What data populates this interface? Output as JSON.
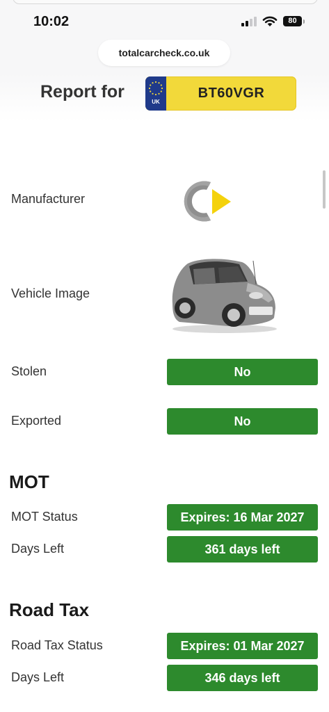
{
  "status_bar": {
    "time": "10:02",
    "battery": "80"
  },
  "browser": {
    "url": "totalcarcheck.co.uk"
  },
  "header": {
    "title": "Report for",
    "plate_country": "UK",
    "registration": "BT60VGR"
  },
  "vehicle": {
    "manufacturer_label": "Manufacturer",
    "manufacturer_logo": "smart-logo",
    "image_label": "Vehicle Image",
    "stolen_label": "Stolen",
    "stolen_value": "No",
    "exported_label": "Exported",
    "exported_value": "No"
  },
  "mot": {
    "heading": "MOT",
    "status_label": "MOT Status",
    "status_value": "Expires: 16 Mar 2027",
    "days_label": "Days Left",
    "days_value": "361 days left"
  },
  "road_tax": {
    "heading": "Road Tax",
    "status_label": "Road Tax Status",
    "status_value": "Expires: 01 Mar 2027",
    "days_label": "Days Left",
    "days_value": "346 days left"
  },
  "colors": {
    "status_green": "#2d8a2d",
    "plate_yellow": "#f2d93a",
    "plate_blue": "#1f3a8a",
    "logo_yellow": "#f4d20c"
  }
}
